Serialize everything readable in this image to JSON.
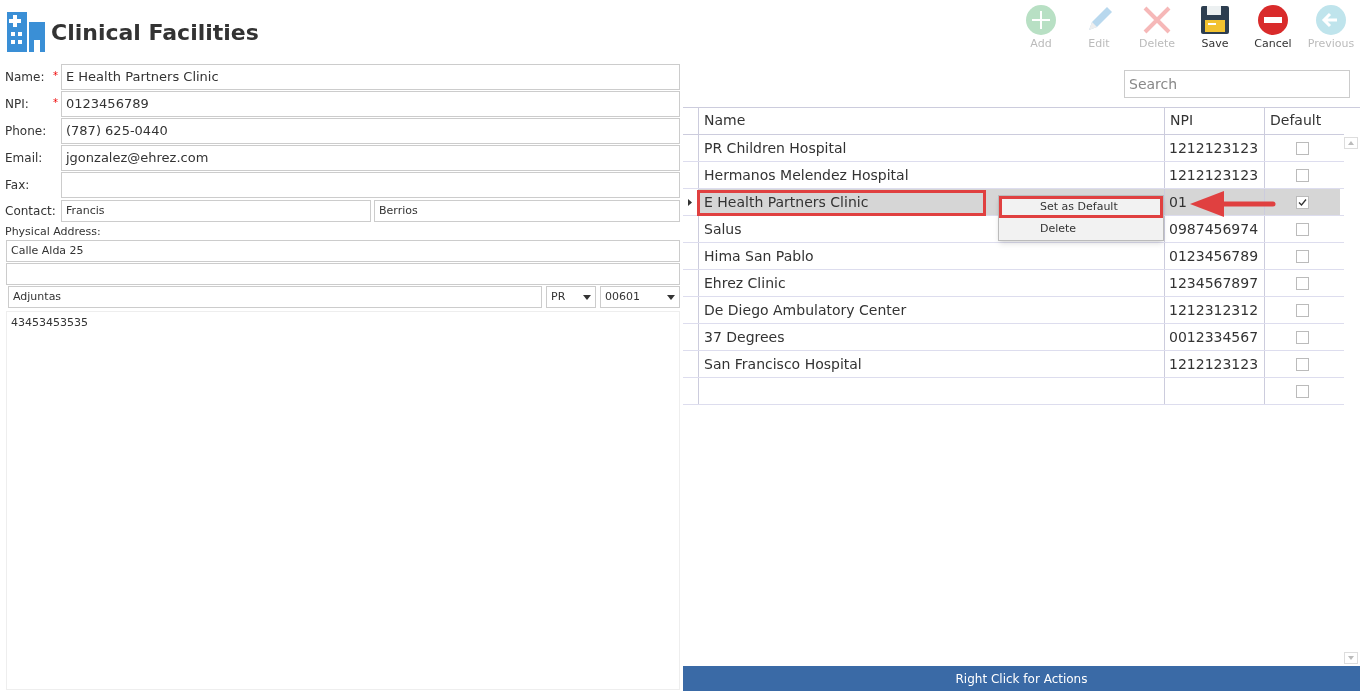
{
  "title": "Clinical Facilities",
  "toolbar": [
    {
      "kind": "add",
      "label": "Add",
      "disabled": true
    },
    {
      "kind": "edit",
      "label": "Edit",
      "disabled": true
    },
    {
      "kind": "delete",
      "label": "Delete",
      "disabled": true
    },
    {
      "kind": "save",
      "label": "Save",
      "disabled": false
    },
    {
      "kind": "cancel",
      "label": "Cancel",
      "disabled": false
    },
    {
      "kind": "previous",
      "label": "Previous",
      "disabled": true
    }
  ],
  "form": {
    "fields": [
      {
        "label": "Name:",
        "value": "E Health Partners Clinic",
        "required_mark": "*"
      },
      {
        "label": "NPI:",
        "value": "0123456789",
        "required_mark": "*"
      },
      {
        "label": "Phone:",
        "value": "(787) 625-0440"
      },
      {
        "label": "Email:",
        "value": "jgonzalez@ehrez.com"
      },
      {
        "label": "Fax:"
      }
    ],
    "contact": {
      "label": "Contact:",
      "first": "Francis",
      "last": "Berrios"
    },
    "address_label": "Physical Address:",
    "address_lines": [
      "Calle Alda 25"
    ],
    "city": "Adjuntas",
    "state": "PR",
    "zip": "00601",
    "notes": "43453453535"
  },
  "search": {
    "placeholder": "Search"
  },
  "table": {
    "columns": [
      "Name",
      "NPI",
      "Default"
    ],
    "rows": [
      {
        "name": "PR Children Hospital",
        "npi": "1212123123",
        "default": false,
        "selected": false
      },
      {
        "name": "Hermanos Melendez Hospital",
        "npi": "1212123123",
        "default": false,
        "selected": false
      },
      {
        "name": "E Health Partners Clinic",
        "npi": "01",
        "default": true,
        "selected": true
      },
      {
        "name": "Salus",
        "npi": "0987456974",
        "default": false,
        "selected": false
      },
      {
        "name": "Hima San Pablo",
        "npi": "0123456789",
        "default": false,
        "selected": false
      },
      {
        "name": "Ehrez  Clinic",
        "npi": "1234567897",
        "default": false,
        "selected": false
      },
      {
        "name": "De Diego Ambulatory Center",
        "npi": "1212312312",
        "default": false,
        "selected": false
      },
      {
        "name": "37 Degrees",
        "npi": "0012334567",
        "default": false,
        "selected": false
      },
      {
        "name": "San Francisco Hospital",
        "npi": "1212123123",
        "default": false,
        "selected": false
      },
      {
        "name": "",
        "npi": "",
        "default": false,
        "selected": false
      }
    ]
  },
  "context_menu": [
    {
      "label": "Set as Default",
      "highlighted": true
    },
    {
      "label": "Delete",
      "highlighted": false
    }
  ],
  "status_bar": "Right Click for Actions"
}
